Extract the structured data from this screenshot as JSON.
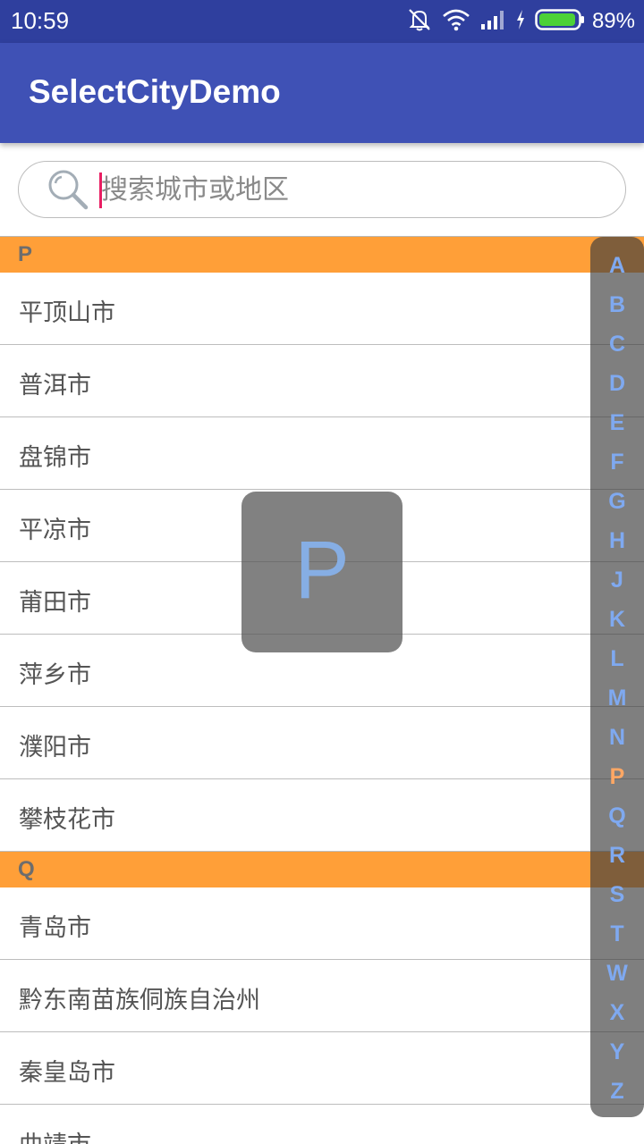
{
  "status_bar": {
    "time": "10:59",
    "battery_percent": "89%",
    "icons": [
      "mute-icon",
      "wifi-icon",
      "signal-icon",
      "charging-icon",
      "battery-icon"
    ]
  },
  "app_bar": {
    "title": "SelectCityDemo"
  },
  "search": {
    "placeholder": "搜索城市或地区",
    "value": ""
  },
  "sections": [
    {
      "letter": "P",
      "cities": [
        "平顶山市",
        "普洱市",
        "盘锦市",
        "平凉市",
        "莆田市",
        "萍乡市",
        "濮阳市",
        "攀枝花市"
      ]
    },
    {
      "letter": "Q",
      "cities": [
        "青岛市",
        "黔东南苗族侗族自治州",
        "秦皇岛市",
        "曲靖市"
      ]
    }
  ],
  "overlay": {
    "letter": "P"
  },
  "index": {
    "letters": [
      "A",
      "B",
      "C",
      "D",
      "E",
      "F",
      "G",
      "H",
      "J",
      "K",
      "L",
      "M",
      "N",
      "P",
      "Q",
      "R",
      "S",
      "T",
      "W",
      "X",
      "Y",
      "Z"
    ],
    "active": "P"
  },
  "colors": {
    "status_bar": "#2f3f9e",
    "app_bar": "#3f51b5",
    "section_header": "#ff9f38",
    "index_letter": "#7fa9f0",
    "index_active": "#ffa764",
    "cursor": "#e91e63"
  }
}
